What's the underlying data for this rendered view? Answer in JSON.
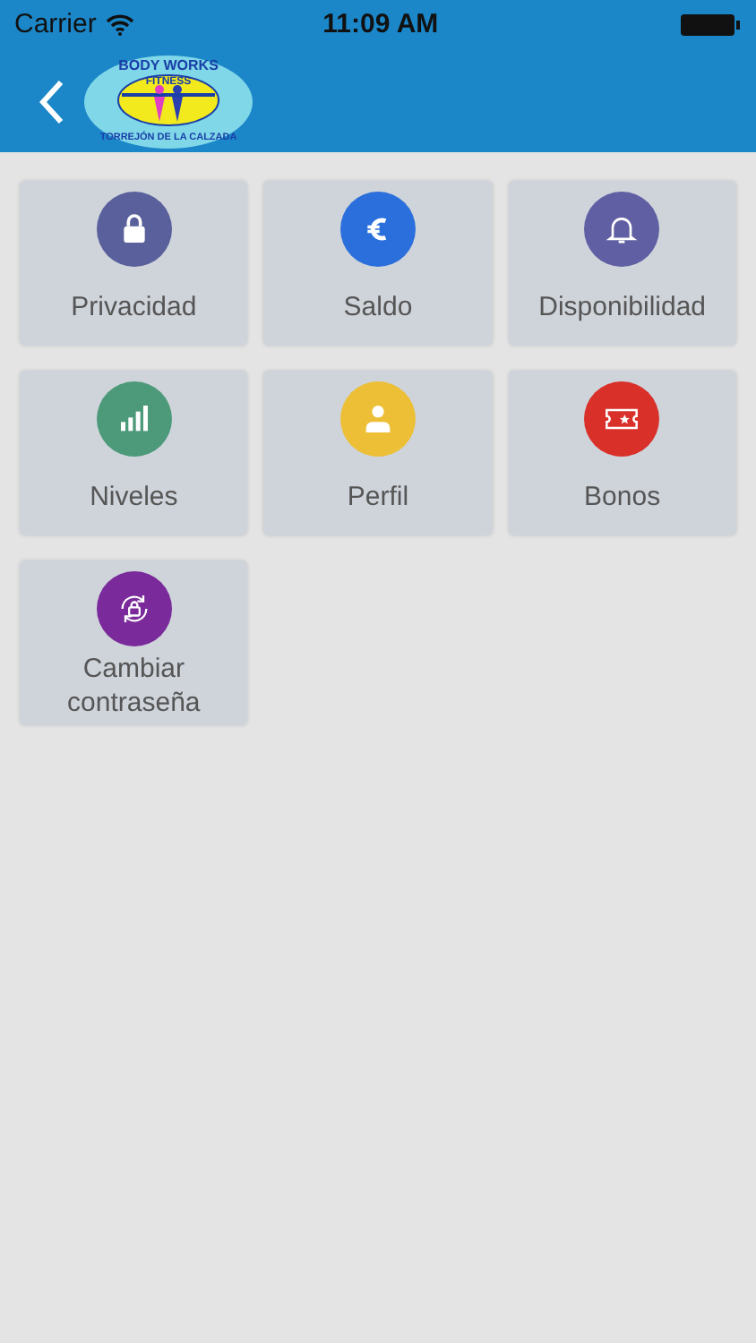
{
  "status_bar": {
    "carrier": "Carrier",
    "time": "11:09 AM"
  },
  "logo": {
    "top": "BODY WORKS",
    "middle": "FITNESS",
    "bottom": "TORREJÓN DE LA CALZADA"
  },
  "tiles": [
    {
      "label": "Privacidad",
      "kind": "lock",
      "color": "#5a609b"
    },
    {
      "label": "Saldo",
      "kind": "euro",
      "color": "#2a6fdb"
    },
    {
      "label": "Disponibilidad",
      "kind": "bell",
      "color": "#605fa3"
    },
    {
      "label": "Niveles",
      "kind": "bars",
      "color": "#4d9a7a"
    },
    {
      "label": "Perfil",
      "kind": "person",
      "color": "#ecbf36"
    },
    {
      "label": "Bonos",
      "kind": "ticket",
      "color": "#d9302a"
    },
    {
      "label": "Cambiar contraseña",
      "kind": "lockcycle",
      "color": "#7a2a9a"
    }
  ]
}
